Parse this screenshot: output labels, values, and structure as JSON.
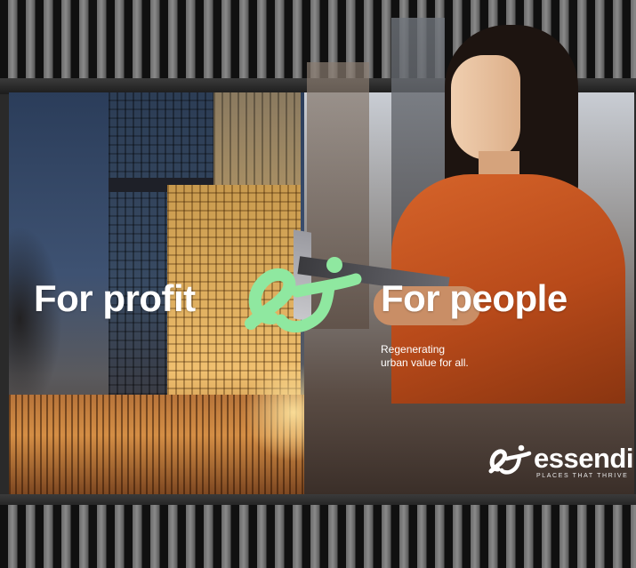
{
  "billboard": {
    "headline_left": "For profit",
    "headline_right": "For people",
    "subcopy_lines": [
      "Regenerating",
      "urban value for all."
    ],
    "brand": {
      "name": "essendi",
      "tagline": "PLACES THAT THRIVE"
    },
    "logo_icon": "essendi-monogram-icon",
    "colors": {
      "logo_green": "#8fe8a0",
      "headline_text": "#ffffff",
      "sweater": "#c9541f"
    }
  }
}
